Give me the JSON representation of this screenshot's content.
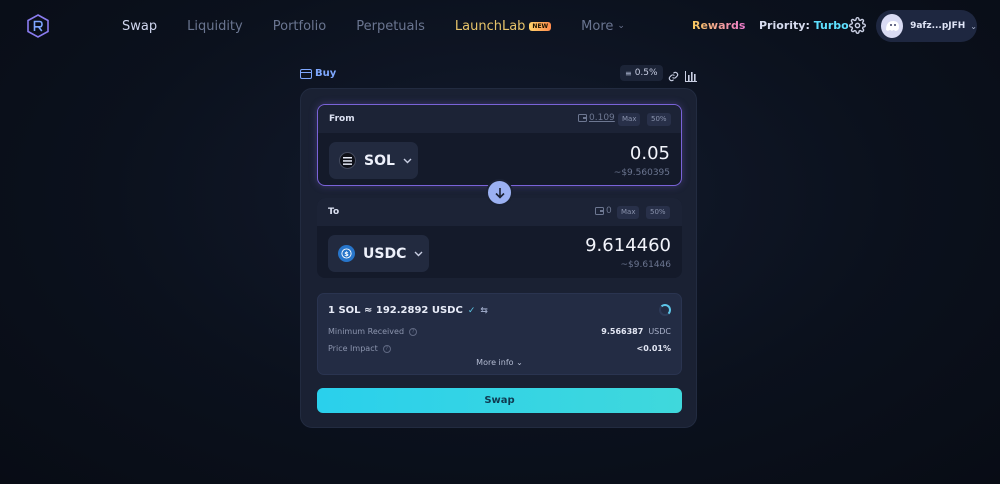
{
  "nav": {
    "items": [
      {
        "label": "Swap",
        "active": true
      },
      {
        "label": "Liquidity"
      },
      {
        "label": "Portfolio"
      },
      {
        "label": "Perpetuals"
      },
      {
        "label": "LaunchLab",
        "badge": "NEW"
      },
      {
        "label": "More"
      }
    ],
    "rewards": "Rewards",
    "priority_label": "Priority:",
    "priority_value": "Turbo",
    "wallet": "9afz...pJFH"
  },
  "toolbar": {
    "buy_label": "Buy",
    "slippage": "0.5%"
  },
  "from": {
    "label": "From",
    "balance": "0.109",
    "max": "Max",
    "half": "50%",
    "token": "SOL",
    "amount": "0.05",
    "usd": "~$9.560395"
  },
  "to": {
    "label": "To",
    "balance": "0",
    "max": "Max",
    "half": "50%",
    "token": "USDC",
    "amount": "9.614460",
    "usd": "~$9.61446"
  },
  "info": {
    "rate": "1 SOL ≈ 192.2892 USDC",
    "min_received_label": "Minimum Received",
    "min_received_value": "9.566387",
    "min_received_unit": "USDC",
    "price_impact_label": "Price Impact",
    "price_impact_value": "<0.01%",
    "more_info": "More info"
  },
  "swap_button": "Swap",
  "colors": {
    "accent": "#2ad0ec",
    "from_border": "#7a63d8",
    "priority": "#5ee0ff"
  }
}
